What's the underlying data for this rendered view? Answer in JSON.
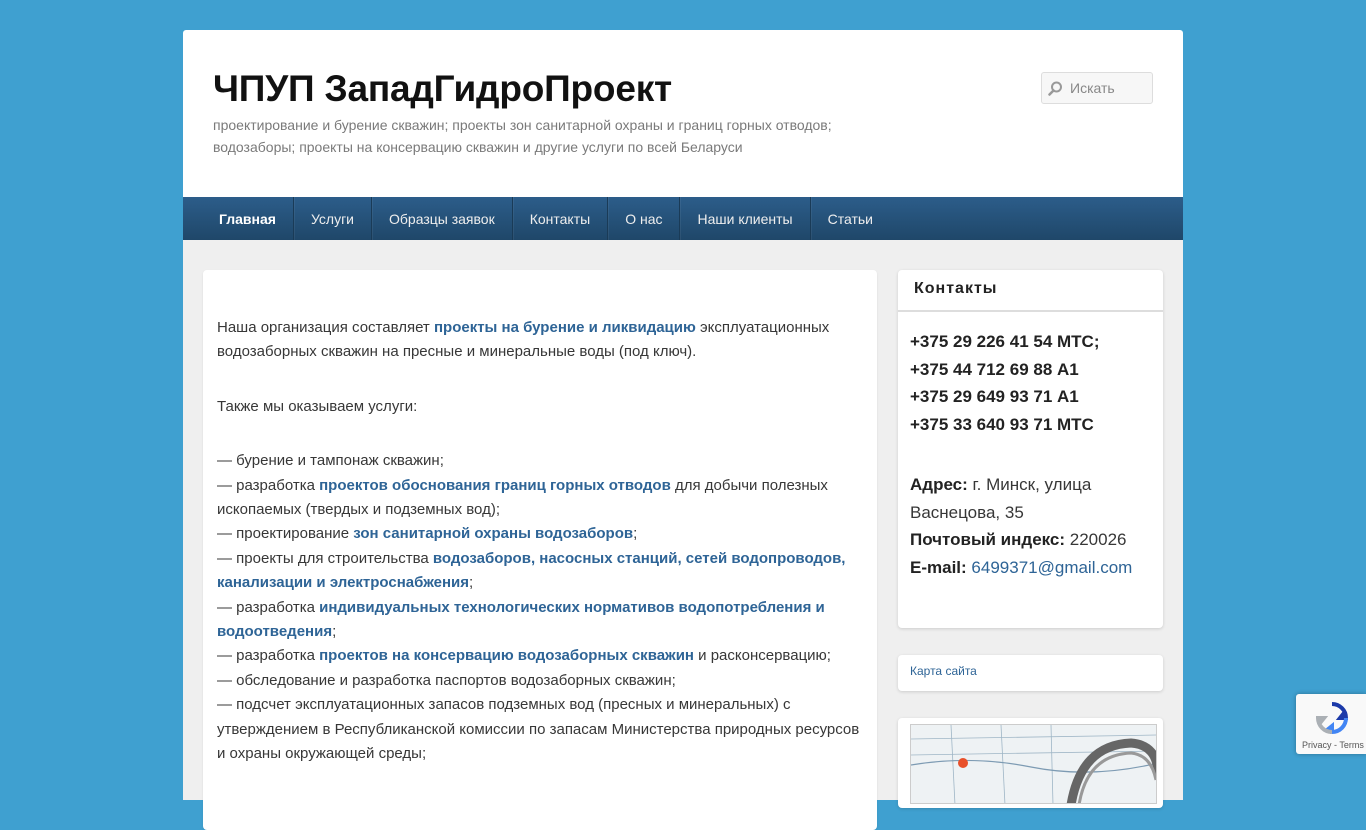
{
  "site": {
    "title": "ЧПУП ЗападГидроПроект",
    "description": "проектирование и бурение скважин; проекты зон санитарной охраны и границ горных отводов; водозаборы; проекты на консервацию скважин и другие услуги по всей Беларуси"
  },
  "search": {
    "placeholder": "Искать",
    "icon": "search-icon"
  },
  "nav": {
    "items": [
      {
        "label": "Главная",
        "active": true
      },
      {
        "label": "Услуги"
      },
      {
        "label": "Образцы заявок"
      },
      {
        "label": "Контакты"
      },
      {
        "label": "О нас"
      },
      {
        "label": "Наши клиенты"
      },
      {
        "label": "Статьи"
      }
    ]
  },
  "content": {
    "intro_before": "Наша организация составляет ",
    "intro_link": "проекты на бурение и ликвидацию",
    "intro_after": " эксплуатационных водозаборных скважин на пресные и минеральные воды (под ключ).",
    "also": "Также мы оказываем услуги:",
    "services": [
      {
        "before": "— бурение и тампонаж скважин;",
        "link": "",
        "after": ""
      },
      {
        "before": "— разработка ",
        "link": "проектов обоснования границ горных отводов",
        "after": " для добычи полезных ископаемых (твердых и подземных вод);"
      },
      {
        "before": "— проектирование ",
        "link": "зон санитарной охраны водозаборов",
        "after": ";"
      },
      {
        "before": "— проекты для строительства ",
        "link": "водозаборов, насосных станций, сетей водопроводов, канализации и электроснабжения",
        "after": ";"
      },
      {
        "before": "— разработка ",
        "link": "индивидуальных технологических нормативов водопотребления и водоотведения",
        "after": ";"
      },
      {
        "before": "— разработка ",
        "link": "проектов на консервацию водозаборных скважин",
        "after": " и расконсервацию;"
      },
      {
        "before": "— обследование и разработка паспортов водозаборных скважин;",
        "link": "",
        "after": ""
      },
      {
        "before": "— подсчет эксплуатационных запасов подземных вод (пресных и минеральных) с утверждением в Республиканской комиссии по запасам Министерства природных ресурсов и охраны окружающей среды;",
        "link": "",
        "after": ""
      }
    ]
  },
  "contacts": {
    "title": "Контакты",
    "phones": [
      "+375 29 226 41 54 МТС;",
      "+375 44 712 69 88 А1",
      "+375 29 649 93 71 А1",
      "+375 33 640 93 71 МТС"
    ],
    "address_label": "Адрес:",
    "address_value": " г. Минск, улица Васнецова, 35",
    "postal_label": "Почтовый индекс:",
    "postal_value": " 220026",
    "email_label": "E-mail:",
    "email_value": "6499371@gmail.com"
  },
  "sitemap": {
    "label": "Карта сайта"
  },
  "recaptcha": {
    "privacy": "Privacy",
    "separator": " - ",
    "terms": "Terms"
  },
  "colors": {
    "background": "#3fa0d0",
    "nav": "#24537e",
    "link": "#2e6496"
  }
}
